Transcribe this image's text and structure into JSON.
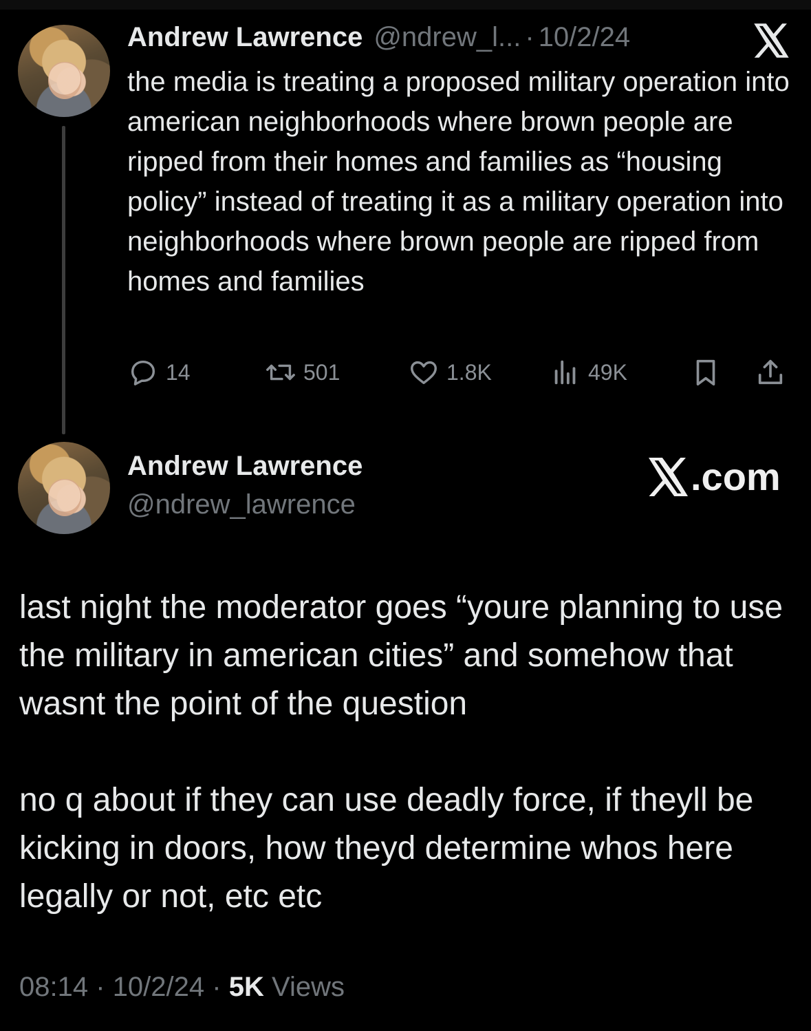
{
  "tweet1": {
    "author_name": "Andrew Lawrence",
    "handle": "@ndrew_l...",
    "separator": "·",
    "date": "10/2/24",
    "text": "the media is treating a proposed military operation into american neighborhoods where brown people are ripped from their homes and families as “housing policy” instead of treating it as a military operation into neighborhoods where brown people are ripped from homes and families",
    "actions": {
      "replies": "14",
      "retweets": "501",
      "likes": "1.8K",
      "views": "49K"
    },
    "icons": [
      "reply-icon",
      "retweet-icon",
      "like-icon",
      "views-icon",
      "bookmark-icon",
      "share-icon",
      "x-logo-icon"
    ]
  },
  "tweet2": {
    "author_name": "Andrew Lawrence",
    "handle": "@ndrew_lawrence",
    "brand_suffix": ".com",
    "text": "last night the moderator goes “youre planning to use the military in american cities” and somehow that wasnt the point of the question\n\nno q about if they can use deadly force, if theyll be kicking in doors, how theyd determine whos here legally or not, etc etc",
    "time": "08:14",
    "separator": "·",
    "date": "10/2/24",
    "views_count": "5K",
    "views_label": "Views"
  },
  "colors": {
    "background": "#000000",
    "text": "#e7e9ea",
    "secondary": "#71767b",
    "thread_line": "#3d3d3d"
  }
}
